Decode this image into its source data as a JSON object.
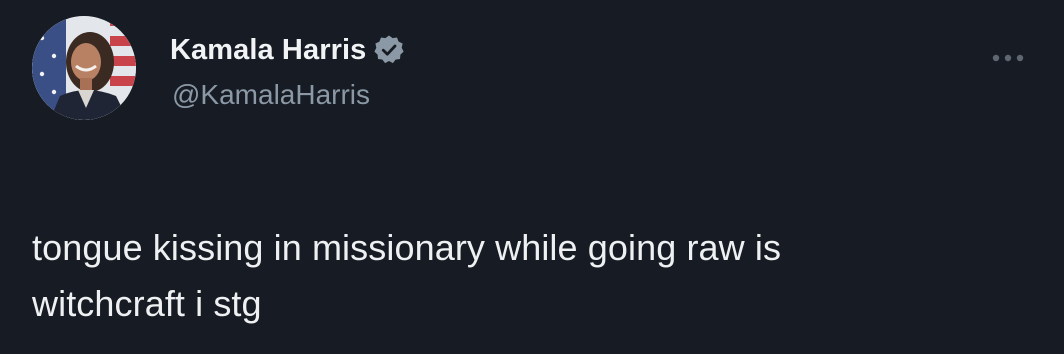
{
  "colors": {
    "background": "#161b24",
    "text_primary": "#eef0f1",
    "text_secondary": "#8b98a5",
    "verified_badge": "#8b98a5"
  },
  "author": {
    "display_name": "Kamala Harris",
    "handle": "@KamalaHarris",
    "verified": true,
    "verified_icon": "verified-badge-icon",
    "avatar_icon": "profile-photo"
  },
  "menu": {
    "icon": "more-options-icon"
  },
  "tweet": {
    "text_line_1": "tongue kissing in missionary while going raw is",
    "text_line_2": "witchcraft i stg"
  }
}
